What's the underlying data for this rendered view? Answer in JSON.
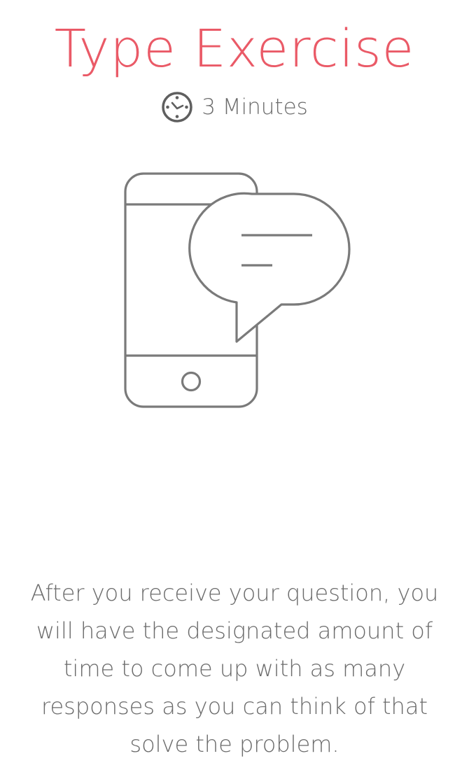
{
  "header": {
    "title": "Type Exercise",
    "duration_label": "3 Minutes",
    "duration_icon": "clock-icon"
  },
  "illustration": {
    "icon": "phone-with-chat-bubble-icon"
  },
  "description": "After you receive your question, you will have the designated amount of time to come up with as many responses as you can think of that solve the problem.",
  "colors": {
    "accent": "#ea5a67",
    "text": "#6b6b6b",
    "icon_stroke": "#7a7a7a",
    "background": "#ffffff"
  }
}
